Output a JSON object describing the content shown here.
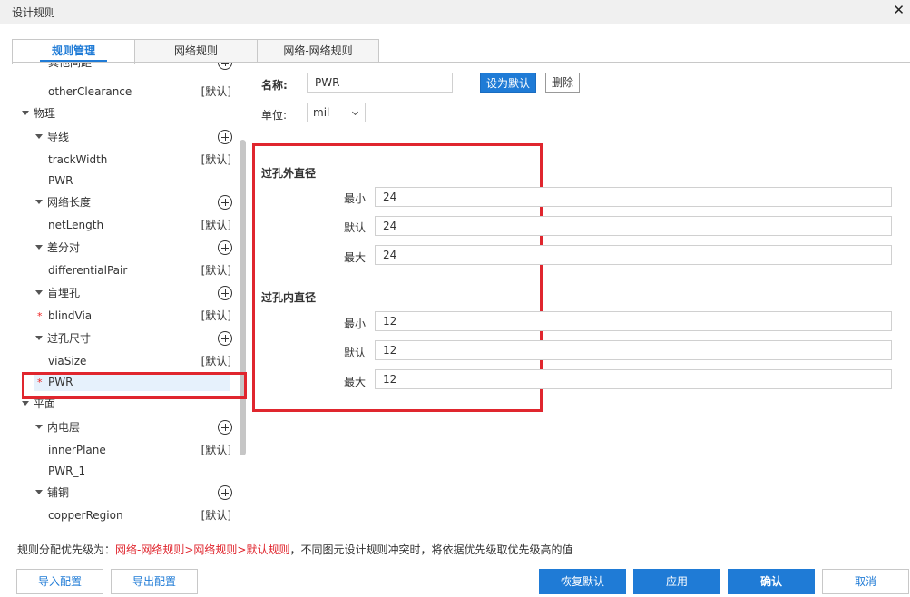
{
  "window": {
    "title": "设计规则",
    "close": "✕"
  },
  "tabs": [
    "规则管理",
    "网络规则",
    "网络-网络规则"
  ],
  "tree": {
    "top_partial": "其他间距",
    "rows": [
      {
        "label": "otherClearance",
        "tag": "[默认]"
      },
      {
        "label": "物理"
      },
      {
        "label": "导线"
      },
      {
        "label": "trackWidth",
        "tag": "[默认]"
      },
      {
        "label": "PWR"
      },
      {
        "label": "网络长度"
      },
      {
        "label": "netLength",
        "tag": "[默认]"
      },
      {
        "label": "差分对"
      },
      {
        "label": "differentialPair",
        "tag": "[默认]"
      },
      {
        "label": "盲埋孔"
      },
      {
        "label": "blindVia",
        "tag": "[默认]",
        "star": "*"
      },
      {
        "label": "过孔尺寸"
      },
      {
        "label": "viaSize",
        "tag": "[默认]"
      },
      {
        "label": "PWR",
        "star": "*"
      },
      {
        "label": "平面"
      },
      {
        "label": "内电层"
      },
      {
        "label": "innerPlane",
        "tag": "[默认]"
      },
      {
        "label": "PWR_1"
      },
      {
        "label": "铺铜"
      },
      {
        "label": "copperRegion",
        "tag": "[默认]"
      }
    ]
  },
  "form": {
    "name_label": "名称:",
    "name_value": "PWR",
    "set_default": "设为默认",
    "delete": "删除",
    "unit_label": "单位:",
    "unit_value": "mil",
    "outer": {
      "title": "过孔外直径",
      "min_label": "最小",
      "min": "24",
      "def_label": "默认",
      "def": "24",
      "max_label": "最大",
      "max": "24"
    },
    "inner": {
      "title": "过孔内直径",
      "min_label": "最小",
      "min": "12",
      "def_label": "默认",
      "def": "12",
      "max_label": "最大",
      "max": "12"
    }
  },
  "note": {
    "prefix": "规则分配优先级为：",
    "priority": "网络-网络规则>网络规则>默认规则",
    "suffix": "，不同图元设计规则冲突时，将依据优先级取优先级高的值"
  },
  "footer": {
    "import": "导入配置",
    "export": "导出配置",
    "restore": "恢复默认",
    "apply": "应用",
    "confirm": "确认",
    "cancel": "取消"
  },
  "colors": {
    "accent": "#1f7bd6",
    "highlight": "#e0262e"
  }
}
